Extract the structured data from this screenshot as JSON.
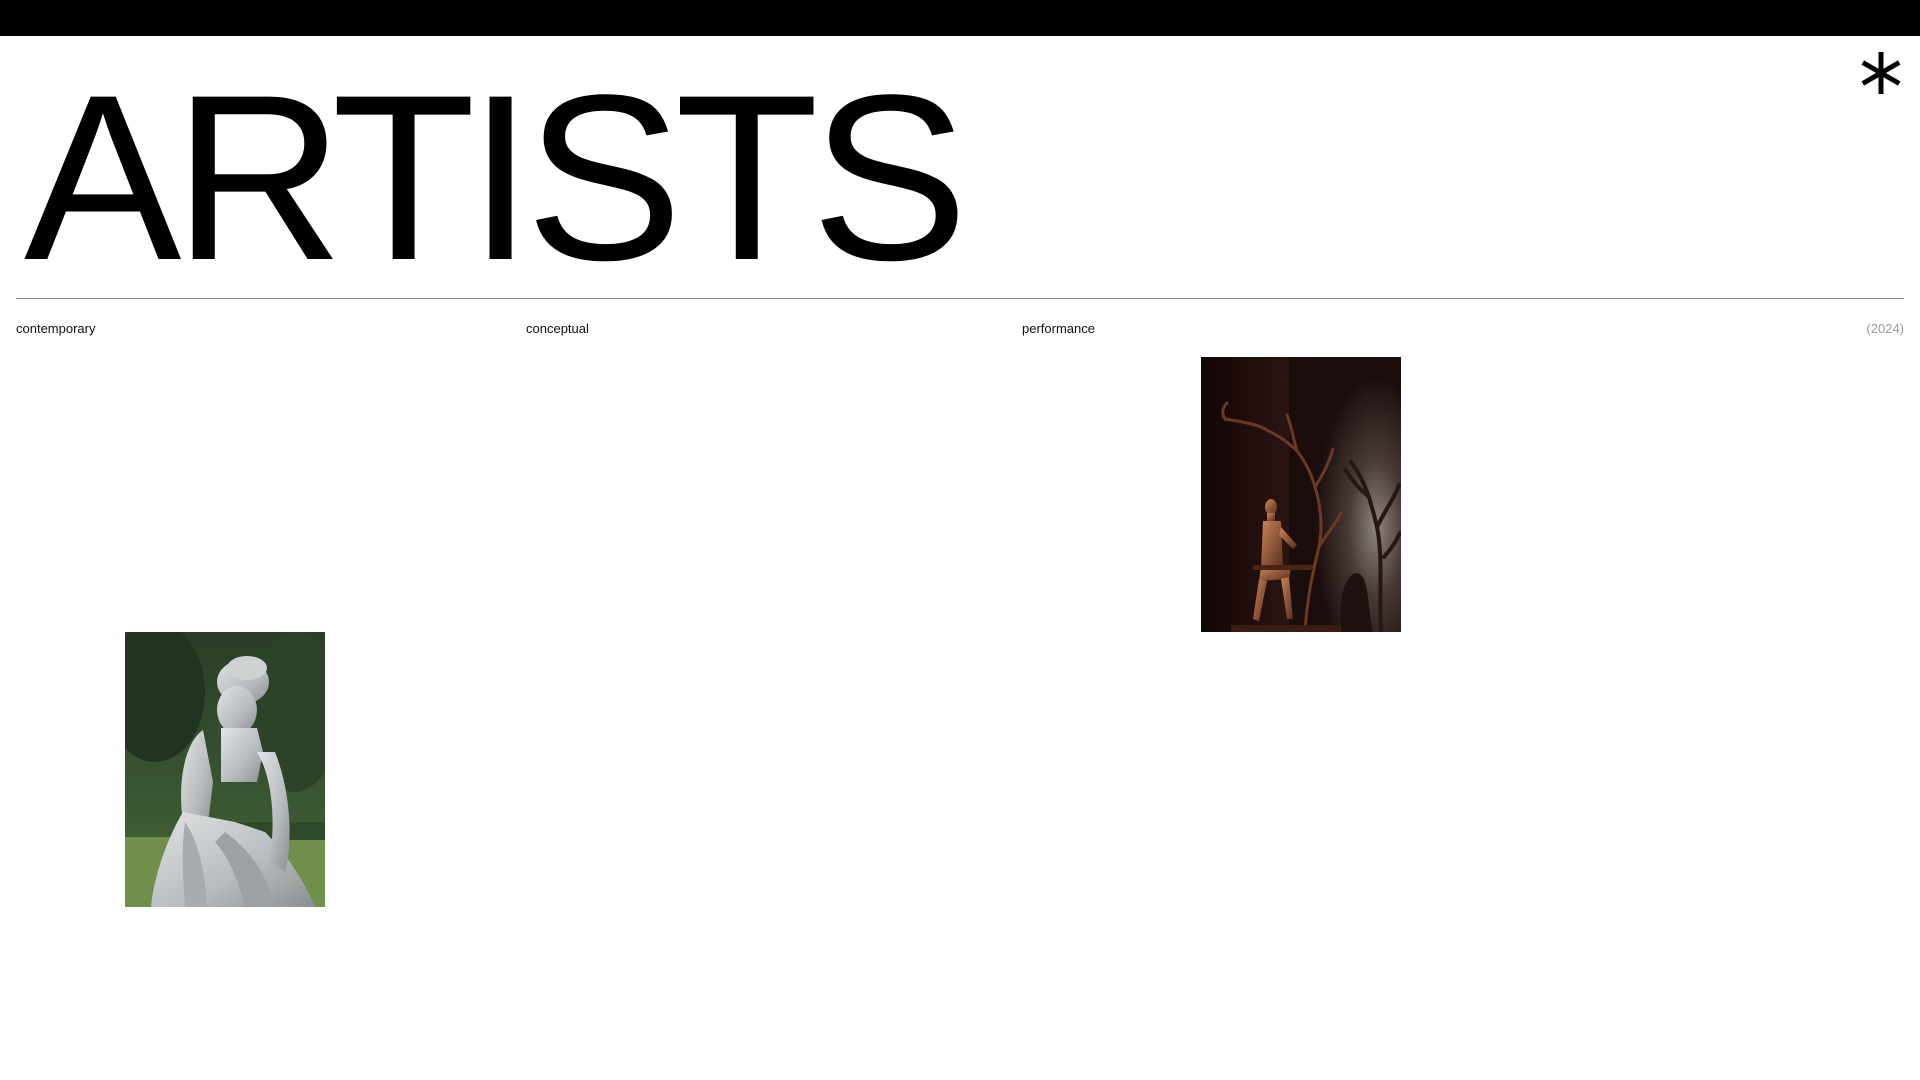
{
  "header": {
    "title": "ARTISTS",
    "menu_icon": "asterisk-icon"
  },
  "filters": {
    "contemporary": "contemporary",
    "conceptual": "conceptual",
    "performance": "performance",
    "year": "(2024)"
  },
  "artworks": [
    {
      "subject": "bronze seated figure beside branch with shadow"
    },
    {
      "subject": "marble statue of seated woman in garden"
    }
  ],
  "colors": {
    "bar": "#000000",
    "background": "#ffffff",
    "text": "#000000",
    "muted": "#9a9a9a",
    "divider": "#8c8c8c"
  }
}
